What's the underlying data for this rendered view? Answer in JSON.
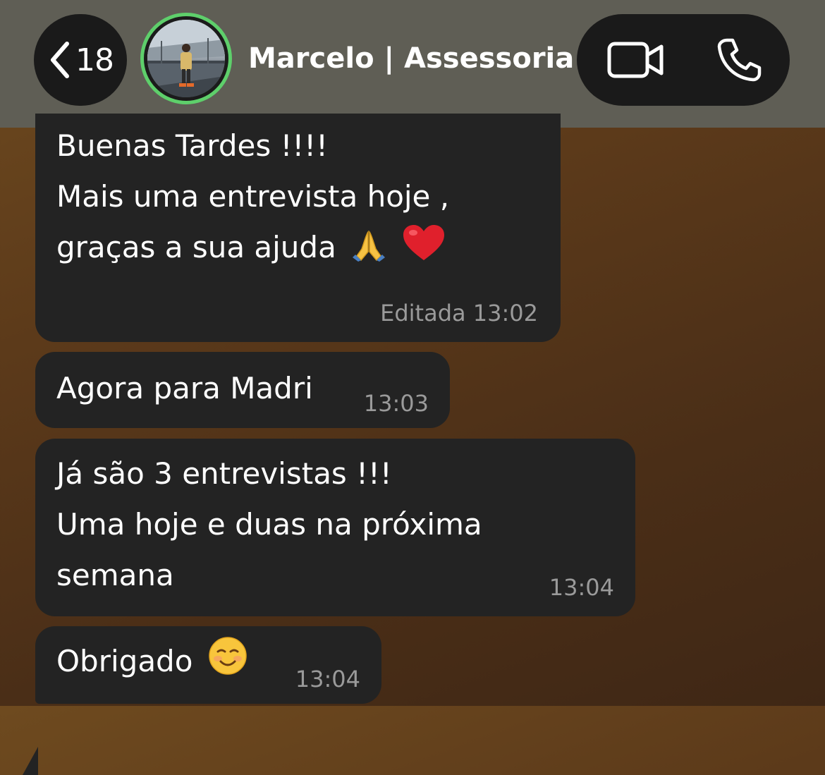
{
  "header": {
    "back_count": "18",
    "contact_name": "Marcelo | Assessoria",
    "ring_color": "#5ecf6b"
  },
  "messages": [
    {
      "lines": [
        "Buenas Tardes !!!!",
        "Mais uma entrevista hoje ,",
        "graças a sua ajuda"
      ],
      "emojis": [
        "folded-hands",
        "red-heart"
      ],
      "edited_label": "Editada",
      "time": "13:02"
    },
    {
      "lines": [
        "Agora para Madri"
      ],
      "time": "13:03"
    },
    {
      "lines": [
        "Já são 3 entrevistas !!!",
        "Uma hoje e duas na próxima",
        "semana"
      ],
      "time": "13:04"
    },
    {
      "lines": [
        "Obrigado"
      ],
      "emojis": [
        "smiling-face"
      ],
      "time": "13:04"
    }
  ],
  "icons": [
    "back-chevron-icon",
    "video-camera-icon",
    "phone-icon"
  ]
}
